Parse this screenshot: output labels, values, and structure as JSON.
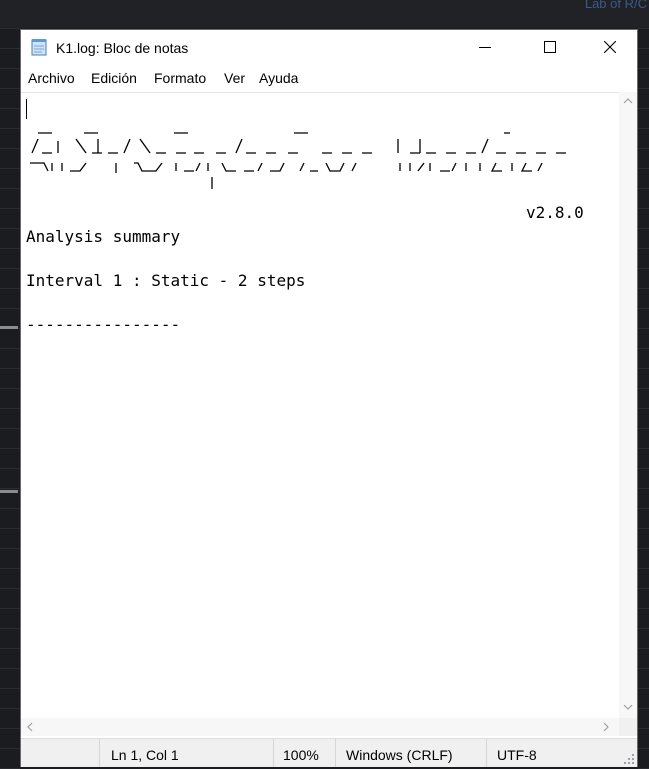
{
  "background": {
    "app_title_fragment": "Lab of R/C"
  },
  "window": {
    "title": "K1.log: Bloc de notas",
    "icon": "notepad-icon"
  },
  "menu": {
    "items": [
      "Archivo",
      "Edición",
      "Formato",
      "Ver",
      "Ayuda"
    ]
  },
  "content": {
    "version": "v2.8.0",
    "lines": [
      "Analysis summary",
      "",
      "Interval 1 : Static - 2 steps",
      "",
      "----------------"
    ]
  },
  "status": {
    "position": "Ln 1, Col 1",
    "zoom": "100%",
    "line_endings": "Windows (CRLF)",
    "encoding": "UTF-8"
  }
}
